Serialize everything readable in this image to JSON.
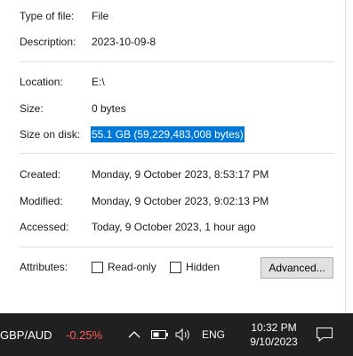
{
  "properties": {
    "type_label": "Type of file:",
    "type_value": "File",
    "description_label": "Description:",
    "description_value": "2023-10-09-8",
    "location_label": "Location:",
    "location_value": "E:\\",
    "size_label": "Size:",
    "size_value": "0 bytes",
    "size_on_disk_label": "Size on disk:",
    "size_on_disk_value": "55.1 GB (59,229,483,008 bytes)",
    "created_label": "Created:",
    "created_value": "Monday, 9 October 2023, 8:53:17 PM",
    "modified_label": "Modified:",
    "modified_value": "Monday, 9 October 2023, 9:02:13 PM",
    "accessed_label": "Accessed:",
    "accessed_value": "Today, 9 October 2023, 1 hour ago",
    "attributes_label": "Attributes:",
    "readonly_label": "Read-only",
    "hidden_label": "Hidden",
    "advanced_label": "Advanced..."
  },
  "taskbar": {
    "ticker_symbol": "GBP/AUD",
    "ticker_change": "-0.25%",
    "ticker_change_color": "#ff5b5b",
    "language": "ENG",
    "time": "10:32 PM",
    "date": "9/10/2023",
    "icons": [
      "chevron-up-icon",
      "battery-icon",
      "volume-icon",
      "notification-icon"
    ]
  },
  "colors": {
    "selection": "#0078d7",
    "taskbar_bg": "#202020"
  }
}
